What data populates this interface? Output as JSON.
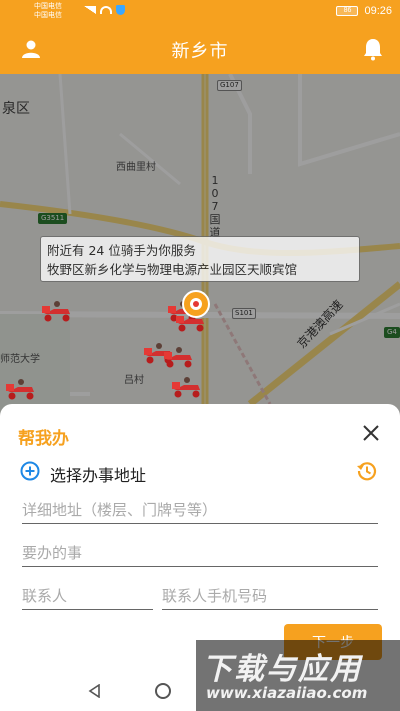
{
  "status_bar": {
    "carrier1": "中国电信",
    "carrier2": "中国电信",
    "battery": "86",
    "time": "09:26"
  },
  "header": {
    "title": "新乡市",
    "left_icon": "user-icon",
    "right_icon": "bell-icon"
  },
  "map": {
    "place_labels": {
      "quan_qu": "泉区",
      "xiqulicun": "西曲里村",
      "lv_cun": "吕村",
      "shifan_daxue": "师范大学"
    },
    "road_tags": {
      "g107": "G107",
      "g3511": "G3511",
      "s101": "S101",
      "g4": "G4"
    },
    "vertical_road": "107国道",
    "highway": "京港澳高速",
    "info_line1": "附近有 24 位骑手为你服务",
    "info_line2": "牧野区新乡化学与物理电源产业园区天顺宾馆"
  },
  "sheet": {
    "title": "帮我办",
    "select_address": "选择办事地址",
    "fields": {
      "detail_address": "详细地址（楼层、门牌号等）",
      "task": "要办的事",
      "contact": "联系人",
      "contact_phone": "联系人手机号码"
    },
    "next_button": "下一步"
  },
  "watermark": {
    "big": "下载与应用",
    "small": "www.xiazaiiao.com"
  },
  "colors": {
    "accent": "#f6a11f",
    "link_blue": "#1e88e5"
  }
}
